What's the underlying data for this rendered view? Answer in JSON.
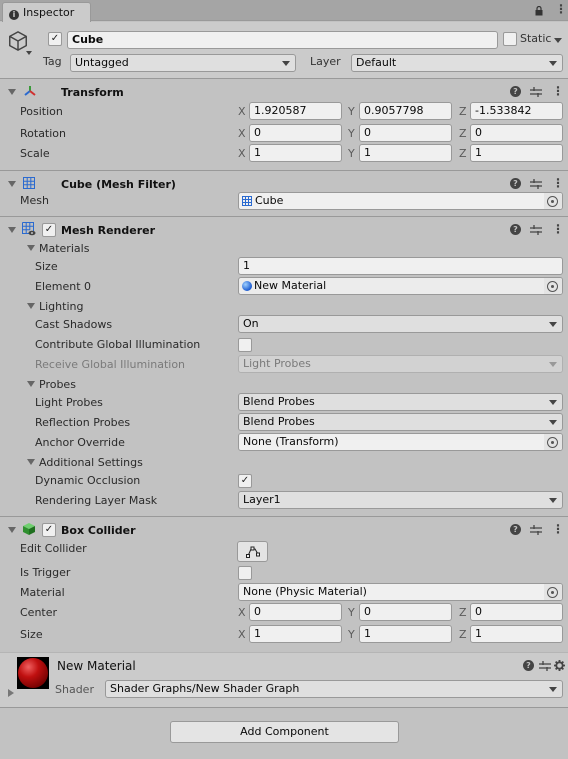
{
  "tab": {
    "title": "Inspector",
    "icon": "info-icon"
  },
  "window_controls": {
    "lock": "lock-icon",
    "menu": "kebab-menu-icon"
  },
  "gameobject": {
    "active": true,
    "name": "Cube",
    "static_label": "Static",
    "static_checked": false,
    "tag_label": "Tag",
    "tag_value": "Untagged",
    "layer_label": "Layer",
    "layer_value": "Default"
  },
  "transform": {
    "title": "Transform",
    "rows": [
      {
        "label": "Position",
        "x": "1.920587",
        "y": "0.9057798",
        "z": "-1.533842"
      },
      {
        "label": "Rotation",
        "x": "0",
        "y": "0",
        "z": "0"
      },
      {
        "label": "Scale",
        "x": "1",
        "y": "1",
        "z": "1"
      }
    ]
  },
  "axes": {
    "x": "X",
    "y": "Y",
    "z": "Z"
  },
  "mesh_filter": {
    "title": "Cube (Mesh Filter)",
    "mesh_label": "Mesh",
    "mesh_value": "Cube"
  },
  "mesh_renderer": {
    "title": "Mesh Renderer",
    "enabled": true,
    "materials_label": "Materials",
    "size_label": "Size",
    "size_value": "1",
    "element0_label": "Element 0",
    "element0_value": "New Material",
    "lighting_label": "Lighting",
    "cast_shadows_label": "Cast Shadows",
    "cast_shadows_value": "On",
    "contribute_gi_label": "Contribute Global Illumination",
    "contribute_gi_checked": false,
    "receive_gi_label": "Receive Global Illumination",
    "receive_gi_value": "Light Probes",
    "probes_label": "Probes",
    "light_probes_label": "Light Probes",
    "light_probes_value": "Blend Probes",
    "reflection_probes_label": "Reflection Probes",
    "reflection_probes_value": "Blend Probes",
    "anchor_override_label": "Anchor Override",
    "anchor_override_value": "None (Transform)",
    "additional_label": "Additional Settings",
    "dynamic_occlusion_label": "Dynamic Occlusion",
    "dynamic_occlusion_checked": true,
    "rendering_layer_label": "Rendering Layer Mask",
    "rendering_layer_value": "Layer1"
  },
  "box_collider": {
    "title": "Box Collider",
    "enabled": true,
    "edit_collider_label": "Edit Collider",
    "is_trigger_label": "Is Trigger",
    "is_trigger_checked": false,
    "material_label": "Material",
    "material_value": "None (Physic Material)",
    "center": {
      "label": "Center",
      "x": "0",
      "y": "0",
      "z": "0"
    },
    "size": {
      "label": "Size",
      "x": "1",
      "y": "1",
      "z": "1"
    }
  },
  "material": {
    "name": "New Material",
    "shader_label": "Shader",
    "shader_value": "Shader Graphs/New Shader Graph",
    "preview_color": "#b01010"
  },
  "add_component_label": "Add Component",
  "check_glyph": "✓"
}
